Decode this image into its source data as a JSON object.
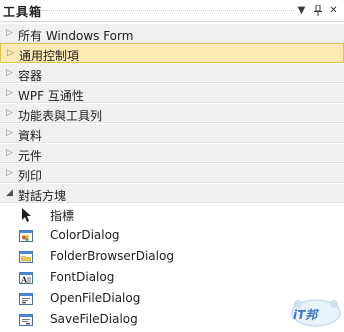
{
  "panel": {
    "title": "工具箱"
  },
  "title_buttons": [
    {
      "name": "dropdown-icon",
      "glyph": "▼"
    },
    {
      "name": "pin-icon",
      "glyph": "ᛜ"
    },
    {
      "name": "close-icon",
      "glyph": "✕"
    }
  ],
  "categories": [
    {
      "label": "所有 Windows Form",
      "state": "collapsed"
    },
    {
      "label": "通用控制項",
      "state": "selected"
    },
    {
      "label": "容器",
      "state": "collapsed"
    },
    {
      "label": "WPF 互通性",
      "state": "collapsed"
    },
    {
      "label": "功能表與工具列",
      "state": "collapsed"
    },
    {
      "label": "資料",
      "state": "collapsed"
    },
    {
      "label": "元件",
      "state": "collapsed"
    },
    {
      "label": "列印",
      "state": "collapsed"
    },
    {
      "label": "對話方塊",
      "state": "expanded"
    }
  ],
  "items": [
    {
      "label": "指標",
      "icon": "pointer-icon"
    },
    {
      "label": "ColorDialog",
      "icon": "color-dialog-icon"
    },
    {
      "label": "FolderBrowserDialog",
      "icon": "folder-browser-dialog-icon"
    },
    {
      "label": "FontDialog",
      "icon": "font-dialog-icon"
    },
    {
      "label": "OpenFileDialog",
      "icon": "open-file-dialog-icon"
    },
    {
      "label": "SaveFileDialog",
      "icon": "save-file-dialog-icon"
    }
  ],
  "watermark": {
    "text": "iT邦"
  },
  "colors": {
    "selected_bg": "#fde9b3",
    "selected_border": "#e3c15a",
    "category_bg": "#f0f0f0",
    "accent": "#3a78c2"
  }
}
